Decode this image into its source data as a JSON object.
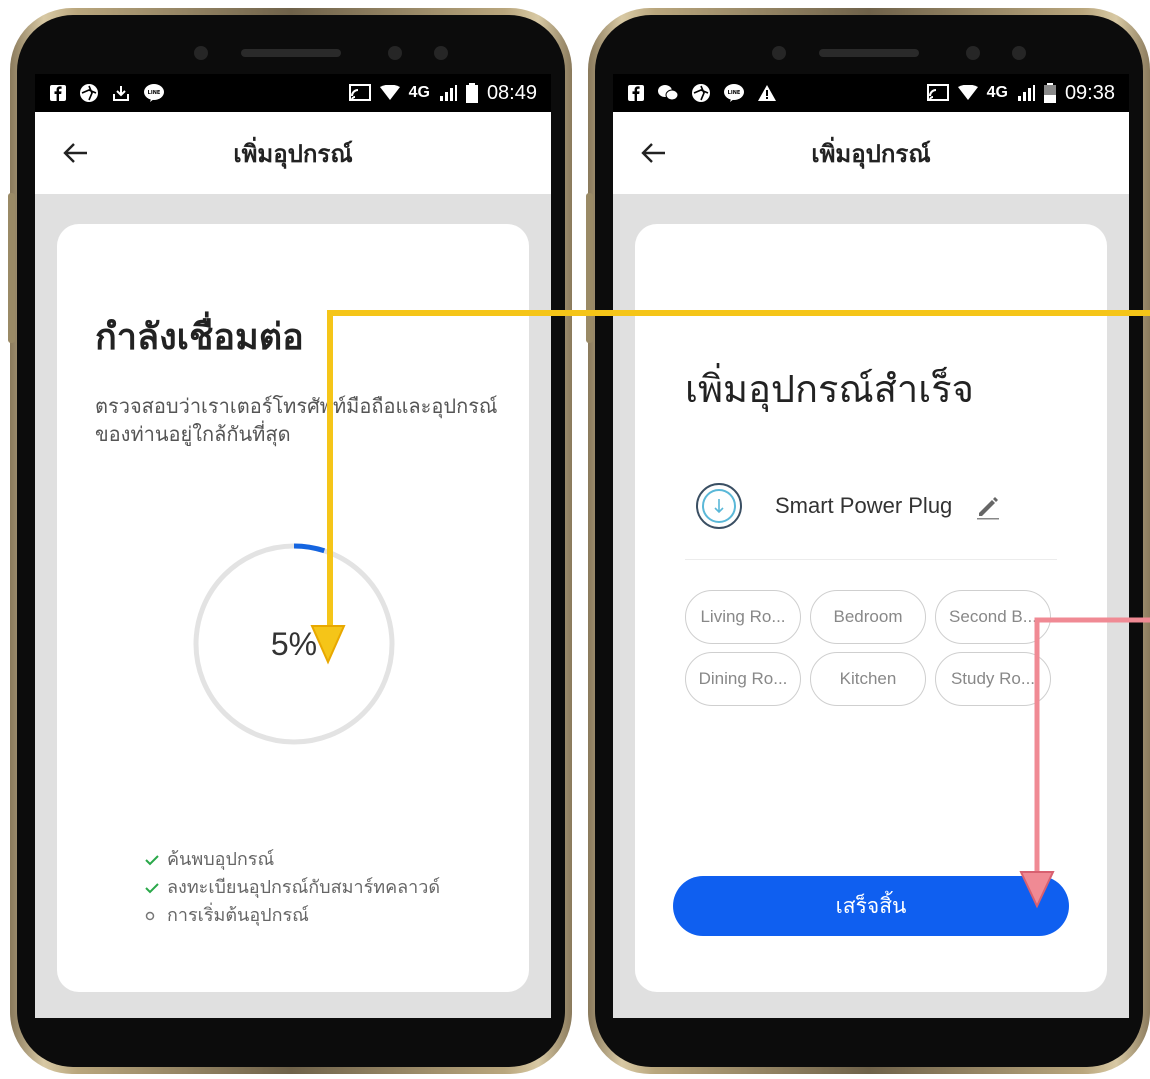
{
  "left_phone": {
    "status": {
      "time": "08:49",
      "network": "4G"
    },
    "appbar": {
      "title": "เพิ่มอุปกรณ์",
      "back_icon": "arrow-left-icon"
    },
    "connecting": {
      "title": "กำลังเชื่อมต่อ",
      "description": "ตรวจสอบว่าเราเตอร์โทรศัพท์มือถือและอุปกรณ์ของท่านอยู่ใกล้กันที่สุด",
      "progress_percent": 5,
      "progress_label": "5%",
      "progress_color": "#1565e0",
      "track_color": "#e3e3e3"
    },
    "steps": [
      {
        "label": "ค้นพบอุปกรณ์",
        "state": "done"
      },
      {
        "label": "ลงทะเบียนอุปกรณ์กับสมาร์ทคลาวด์",
        "state": "done"
      },
      {
        "label": "การเริ่มต้นอุปกรณ์",
        "state": "pending"
      }
    ]
  },
  "right_phone": {
    "status": {
      "time": "09:38",
      "network": "4G"
    },
    "appbar": {
      "title": "เพิ่มอุปกรณ์",
      "back_icon": "arrow-left-icon"
    },
    "success": {
      "title": "เพิ่มอุปกรณ์สำเร็จ"
    },
    "device": {
      "name": "Smart Power Plug",
      "icon": "smart-plug-icon",
      "edit_icon": "pencil-icon"
    },
    "rooms": [
      "Living Ro...",
      "Bedroom",
      "Second B...",
      "Dining Ro...",
      "Kitchen",
      "Study Ro..."
    ],
    "done_button": {
      "label": "เสร็จสิ้น",
      "color": "#0f5ff0"
    }
  },
  "annotations": {
    "yellow_arrow_color": "#f5c518",
    "pink_arrow_color": "#f08a94"
  }
}
